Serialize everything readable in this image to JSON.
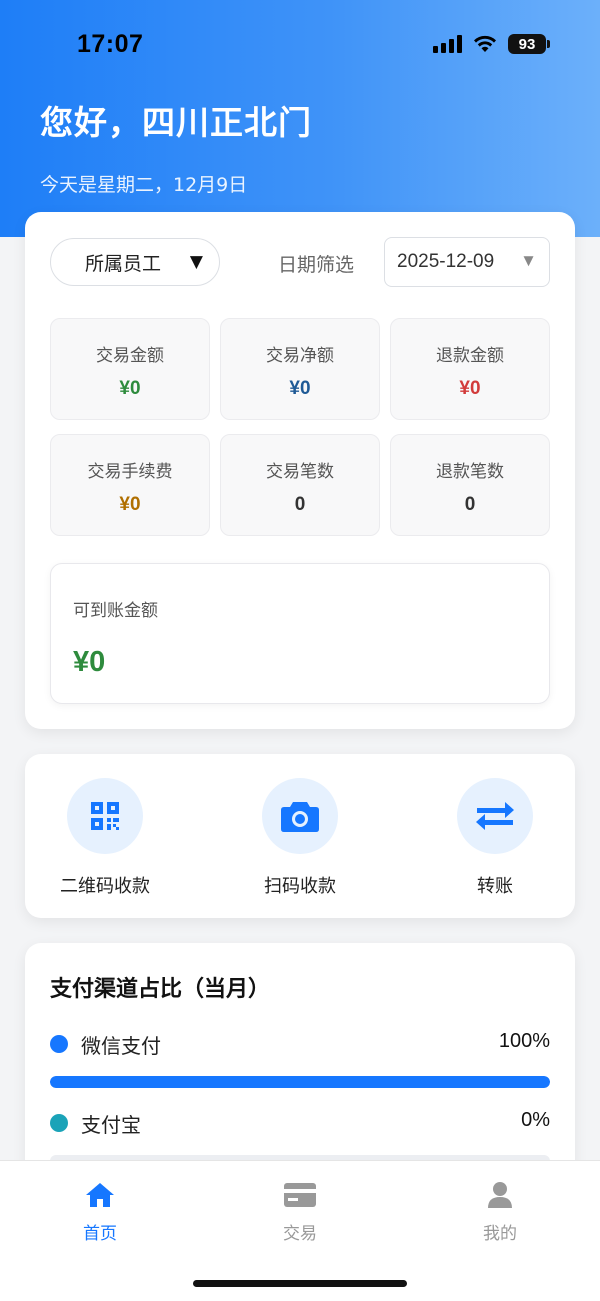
{
  "status_bar": {
    "time": "17:07",
    "battery": "93"
  },
  "header": {
    "greeting": "您好，四川正北门",
    "date_text": "今天是星期二，12月9日"
  },
  "filters": {
    "employee_label": "所属员工",
    "date_filter_label": "日期筛选",
    "date_value": "2025-12-09"
  },
  "stats": [
    {
      "label": "交易金额",
      "value": "¥0",
      "color": "#2e8b3d"
    },
    {
      "label": "交易净额",
      "value": "¥0",
      "color": "#1f5a96"
    },
    {
      "label": "退款金额",
      "value": "¥0",
      "color": "#d23b3b"
    },
    {
      "label": "交易手续费",
      "value": "¥0",
      "color": "#b06f00"
    },
    {
      "label": "交易笔数",
      "value": "0",
      "color": "#333333"
    },
    {
      "label": "退款笔数",
      "value": "0",
      "color": "#333333"
    }
  ],
  "payable": {
    "label": "可到账金额",
    "value": "¥0"
  },
  "actions": [
    {
      "label": "二维码收款",
      "icon": "qr-code-icon"
    },
    {
      "label": "扫码收款",
      "icon": "camera-icon"
    },
    {
      "label": "转账",
      "icon": "transfer-icon"
    }
  ],
  "channels": {
    "title": "支付渠道占比（当月）",
    "items": [
      {
        "name": "微信支付",
        "percent_text": "100%",
        "share": 1.0,
        "color": "#1677ff"
      },
      {
        "name": "支付宝",
        "percent_text": "0%",
        "share": 0.0,
        "color": "#1aa3b8"
      }
    ]
  },
  "tabs": [
    {
      "label": "首页",
      "icon": "home-icon",
      "active": true
    },
    {
      "label": "交易",
      "icon": "card-icon",
      "active": false
    },
    {
      "label": "我的",
      "icon": "user-icon",
      "active": false
    }
  ],
  "colors": {
    "accent": "#1677ff",
    "inactive": "#999999"
  }
}
